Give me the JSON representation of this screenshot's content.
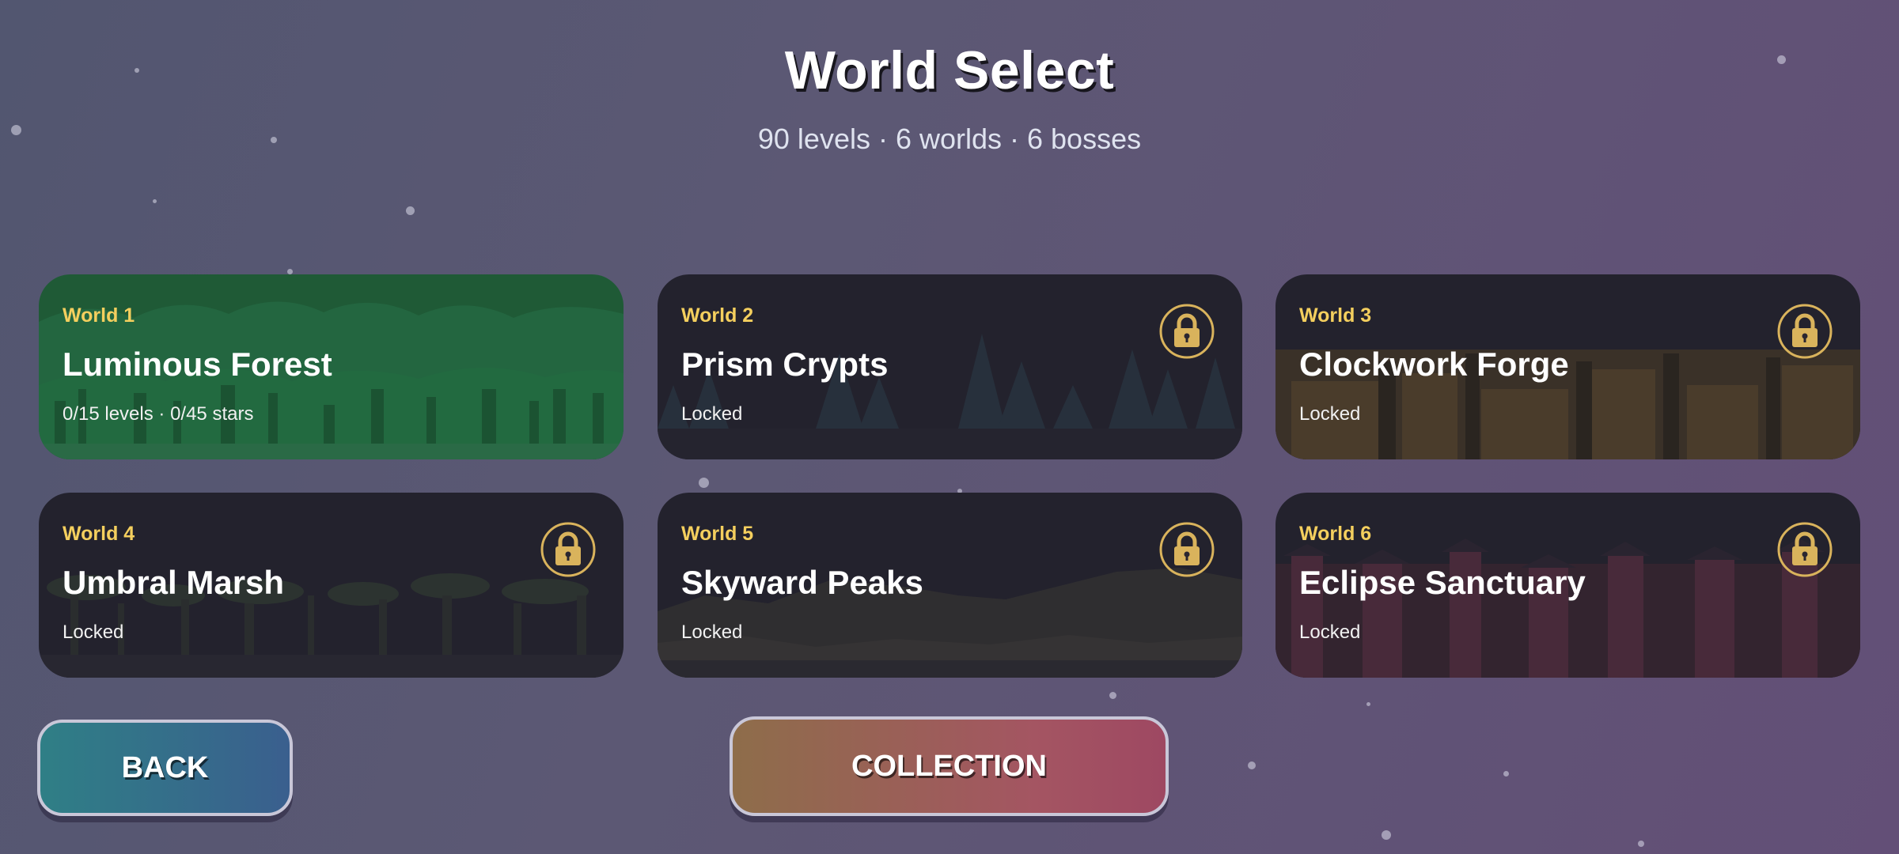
{
  "header": {
    "title": "World Select",
    "subtitle": "90 levels · 6 worlds · 6 bosses"
  },
  "worlds": [
    {
      "number": "World 1",
      "name": "Luminous Forest",
      "status": "0/15 levels · 0/45 stars",
      "locked": false,
      "theme": "forest"
    },
    {
      "number": "World 2",
      "name": "Prism Crypts",
      "status": "Locked",
      "locked": true,
      "theme": "crypts"
    },
    {
      "number": "World 3",
      "name": "Clockwork Forge",
      "status": "Locked",
      "locked": true,
      "theme": "forge"
    },
    {
      "number": "World 4",
      "name": "Umbral Marsh",
      "status": "Locked",
      "locked": true,
      "theme": "marsh"
    },
    {
      "number": "World 5",
      "name": "Skyward Peaks",
      "status": "Locked",
      "locked": true,
      "theme": "peaks"
    },
    {
      "number": "World 6",
      "name": "Eclipse Sanctuary",
      "status": "Locked",
      "locked": true,
      "theme": "sanctuary"
    }
  ],
  "buttons": {
    "back": "BACK",
    "collection": "COLLECTION"
  },
  "icons": {
    "lock": "lock-icon"
  },
  "colors": {
    "accent_gold": "#f4cf5e",
    "unlocked_card": "#1f5a36",
    "locked_card": "#23222d"
  }
}
